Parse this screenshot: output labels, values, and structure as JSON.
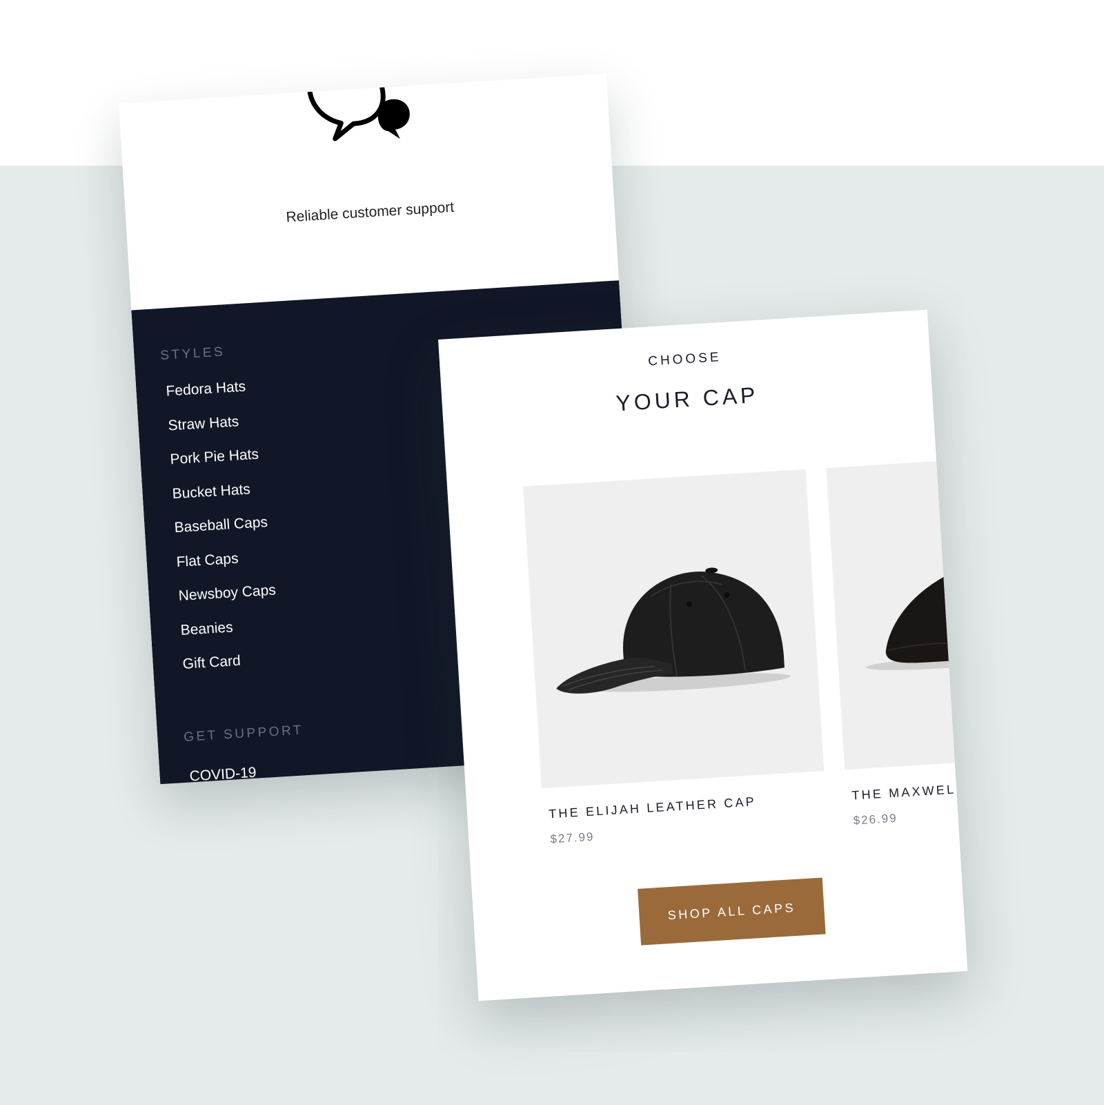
{
  "support": {
    "icon": "chat-bubbles-icon",
    "text": "Reliable customer support"
  },
  "footer": {
    "styles_heading": "STYLES",
    "styles_links": [
      "Fedora Hats",
      "Straw Hats",
      "Pork Pie Hats",
      "Bucket Hats",
      "Baseball Caps",
      "Flat Caps",
      "Newsboy Caps",
      "Beanies",
      "Gift Card"
    ],
    "support_heading": "GET SUPPORT",
    "support_links": [
      "COVID-19"
    ]
  },
  "collection": {
    "eyebrow": "CHOOSE",
    "title": "YOUR CAP",
    "products": [
      {
        "name": "THE ELIJAH LEATHER CAP",
        "price": "$27.99",
        "image": "black-leather-baseball-cap"
      },
      {
        "name": "THE MAXWELL CAP",
        "price": "$26.99",
        "image": "black-flat-cap"
      }
    ],
    "button_label": "SHOP ALL CAPS"
  },
  "colors": {
    "background_band": "#e4ebea",
    "footer_dark": "#111726",
    "accent_button": "#9b6a3a"
  }
}
